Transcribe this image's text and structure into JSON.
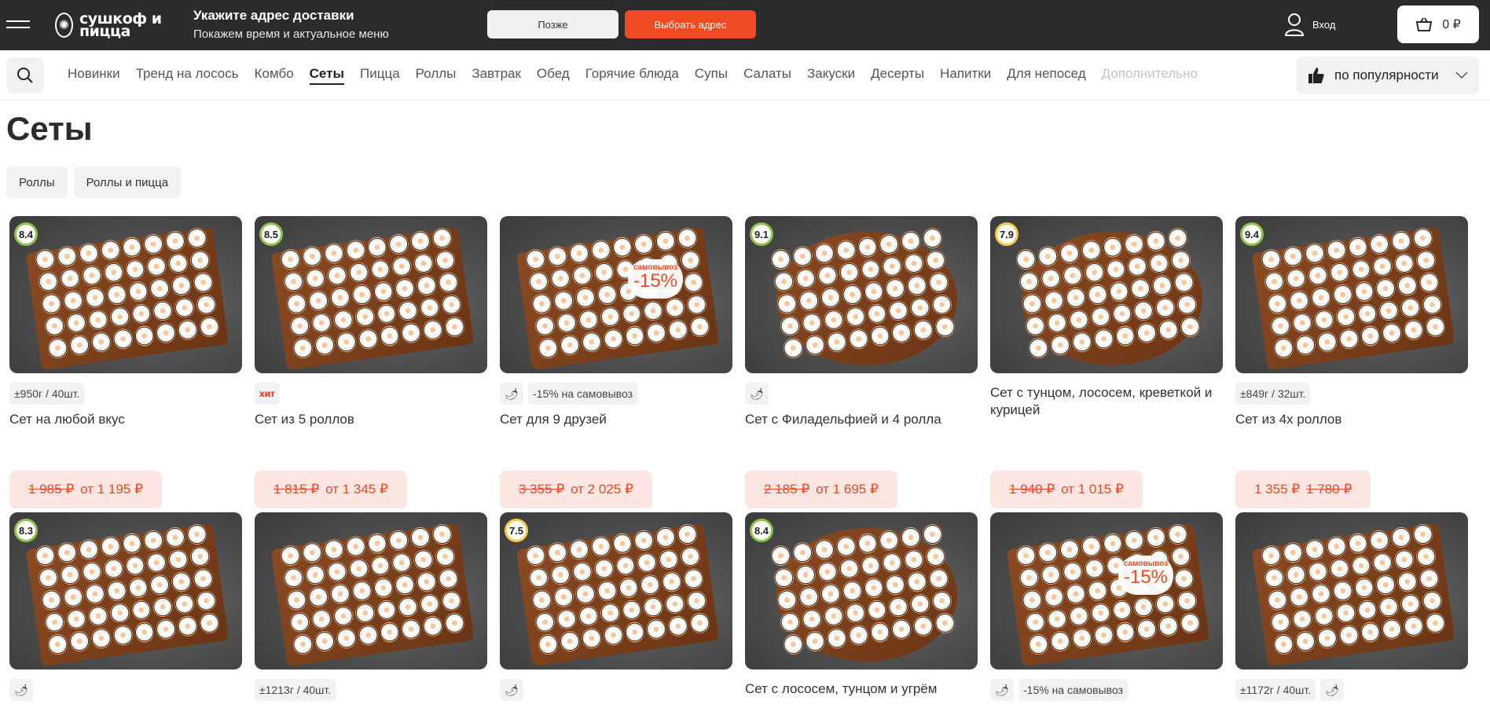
{
  "header": {
    "logo_text": "сушкоф и пицца",
    "address_title": "Укажите адрес доставки",
    "address_subtitle": "Покажем время и актуальное меню",
    "later_label": "Позже",
    "select_label": "Выбрать адрес",
    "login_label": "Вход",
    "cart_total": "0 ₽"
  },
  "nav": {
    "categories": [
      "Новинки",
      "Тренд на лосось",
      "Комбо",
      "Сеты",
      "Пицца",
      "Роллы",
      "Завтрак",
      "Обед",
      "Горячие блюда",
      "Супы",
      "Салаты",
      "Закуски",
      "Десерты",
      "Напитки",
      "Для непосед",
      "Дополнительно"
    ],
    "active": "Сеты",
    "sort_label": "по популярности"
  },
  "page": {
    "title": "Сеты",
    "filters": [
      "Роллы",
      "Роллы и пицца"
    ]
  },
  "cards": [
    {
      "rating": "8.4",
      "weight": "±950г / 40шт.",
      "name": "Сет на любой вкус",
      "old_price": "1 985 ₽",
      "price": "от 1 195 ₽"
    },
    {
      "rating": "8.5",
      "tag_hit": "хит",
      "name": "Сет из 5 роллов",
      "old_price": "1 815 ₽",
      "price": "от 1 345 ₽"
    },
    {
      "promo_top": "самовывоз",
      "promo_value": "-15%",
      "pickup_tag": "-15% на самовывоз",
      "name": "Сет для 9 друзей",
      "old_price": "3 355 ₽",
      "price": "от 2 025 ₽"
    },
    {
      "rating": "9.1",
      "name": "Сет с Филадельфией и 4 ролла",
      "old_price": "2 185 ₽",
      "price": "от 1 695 ₽"
    },
    {
      "rating": "7.9",
      "name": "Сет с тунцом, лососем, креветкой и курицей",
      "old_price": "1 940 ₽",
      "price": "от 1 015 ₽"
    },
    {
      "rating": "9.4",
      "weight": "±849г / 32шт.",
      "name": "Сет из 4х роллов",
      "price": "1 355 ₽",
      "old_price": "1 780 ₽"
    },
    {
      "rating": "8.3"
    },
    {
      "weight": "±1213г / 40шт."
    },
    {
      "rating": "7.5"
    },
    {
      "rating": "8.4",
      "name": "Сет с лососем, тунцом и угрём"
    },
    {
      "promo_top": "самовывоз",
      "promo_value": "-15%",
      "pickup_tag": "-15% на самовывоз"
    },
    {
      "weight": "±1172г / 40шт."
    }
  ]
}
